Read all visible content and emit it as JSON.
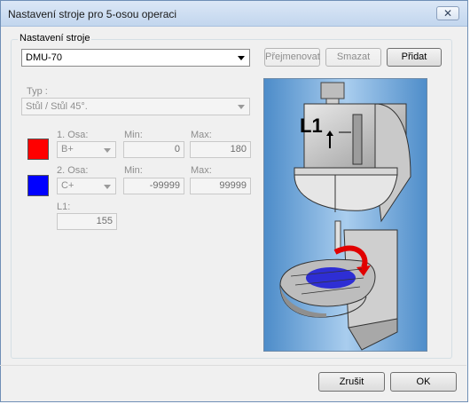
{
  "window": {
    "title": "Nastavení stroje pro 5-osou operaci",
    "close_glyph": "✕"
  },
  "group": {
    "label": "Nastavení stroje"
  },
  "machine": {
    "selected": "DMU-70"
  },
  "buttons": {
    "rename": "Přejmenovat",
    "delete": "Smazat",
    "add": "Přidat",
    "cancel": "Zrušit",
    "ok": "OK"
  },
  "type": {
    "label": "Typ :",
    "selected": "Stůl / Stůl 45°."
  },
  "axis1": {
    "label": "1. Osa:",
    "value": "B+",
    "min_label": "Min:",
    "min": "0",
    "max_label": "Max:",
    "max": "180",
    "color": "#ff0000"
  },
  "axis2": {
    "label": "2. Osa:",
    "value": "C+",
    "min_label": "Min:",
    "min": "-99999",
    "max_label": "Max:",
    "max": "99999",
    "color": "#0000ff"
  },
  "l1": {
    "label": "L1:",
    "value": "155"
  },
  "illustration": {
    "label": "L1"
  }
}
